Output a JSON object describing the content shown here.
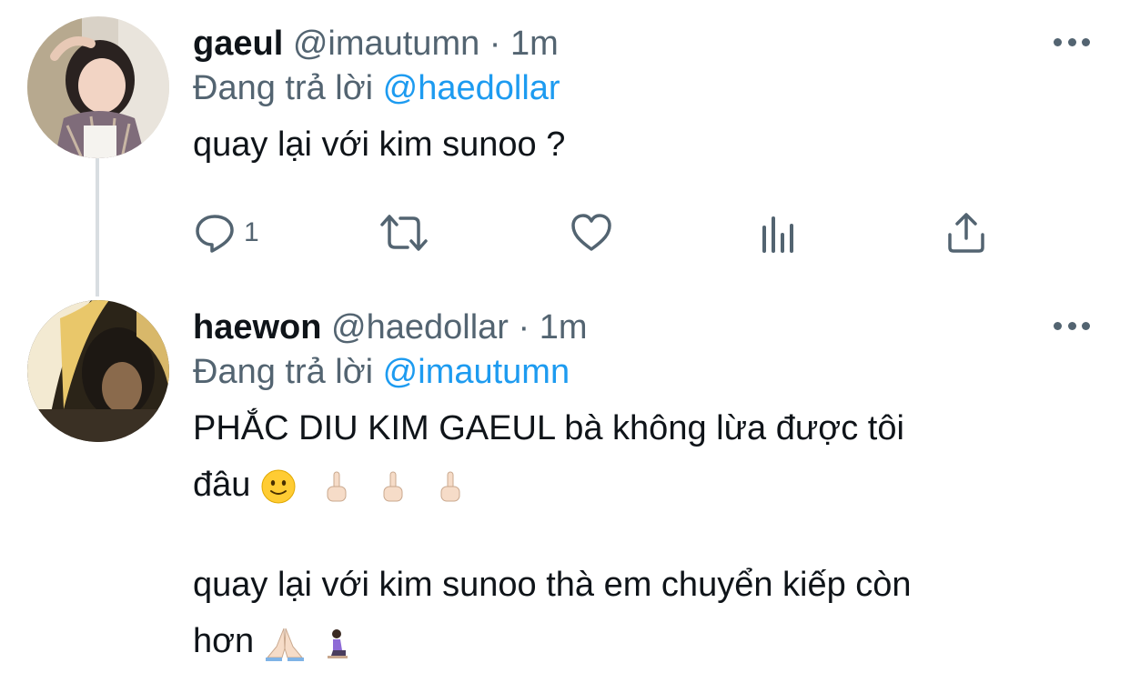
{
  "tweets": [
    {
      "display_name": "gaeul",
      "handle": "@imautumn",
      "separator": "·",
      "time": "1m",
      "replying_prefix": "Đang trả lời",
      "replying_to": "@haedollar",
      "text_lines": [
        "quay lại với kim sunoo ?"
      ],
      "reply_count": "1",
      "icons": {
        "reply": "reply-icon",
        "retweet": "retweet-icon",
        "like": "heart-icon",
        "analytics": "analytics-icon",
        "share": "share-icon",
        "more": "more-icon"
      }
    },
    {
      "display_name": "haewon",
      "handle": "@haedollar",
      "separator": "·",
      "time": "1m",
      "replying_prefix": "Đang trả lời",
      "replying_to": "@imautumn",
      "text_lines": [
        "PHẮC DIU KIM GAEUL bà không lừa được tôi",
        "đâu",
        "",
        "quay lại với kim sunoo thà em chuyển kiếp còn",
        "hơn"
      ],
      "emojis": {
        "line2": [
          "slightly-smiling-face",
          "middle-finger",
          "middle-finger",
          "middle-finger"
        ],
        "line5": [
          "folded-hands",
          "person-kneeling"
        ]
      }
    }
  ],
  "colors": {
    "text_primary": "#0f1419",
    "text_secondary": "#536471",
    "link": "#1d9bf0",
    "thread_line": "#d8dde1"
  }
}
